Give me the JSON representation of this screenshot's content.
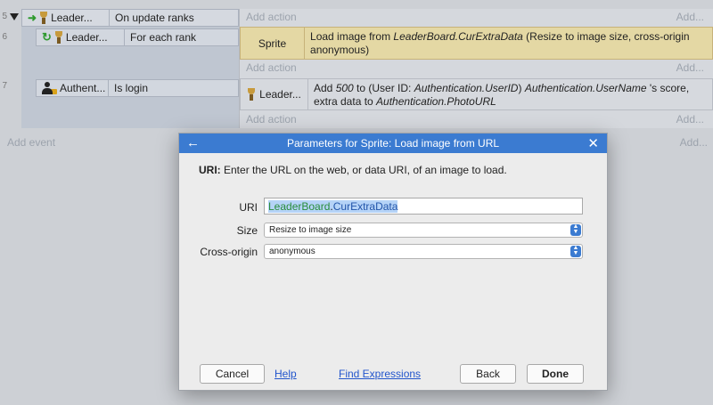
{
  "sheet": {
    "row_numbers": [
      "5",
      "6",
      "7"
    ],
    "events": [
      {
        "object": "Leader...",
        "condition": "On update ranks",
        "add_action": "Add action",
        "add_right": "Add..."
      },
      {
        "object": "Leader...",
        "condition": "For each rank",
        "action_object": "Sprite",
        "action_text_pre": "Load image from ",
        "action_text_em": "LeaderBoard.CurExtraData",
        "action_text_post": " (Resize to image size, cross-origin anonymous)",
        "add_action": "Add action",
        "add_right": "Add..."
      },
      {
        "object": "Authent...",
        "condition": "Is login",
        "action_object": "Leader...",
        "action_line1_a": "Add ",
        "action_line1_b": "500",
        "action_line1_c": " to (User ID: ",
        "action_line1_d": "Authentication.UserID",
        "action_line1_e": ") ",
        "action_line1_f": "Authentication.UserName",
        "action_line1_g": " 's score,",
        "action_line2_a": "extra data to ",
        "action_line2_b": "Authentication.PhotoURL",
        "add_action": "Add action",
        "add_right": "Add..."
      }
    ],
    "add_event": "Add event",
    "add_event_right": "Add..."
  },
  "dialog": {
    "title": "Parameters for Sprite: Load image from URL",
    "intro_bold": "URI:",
    "intro_text": " Enter the URL on the web, or data URI, of an image to load.",
    "params": {
      "uri_label": "URI",
      "uri_value_a": "LeaderBoard",
      "uri_value_b": ".",
      "uri_value_c": "CurExtraData",
      "size_label": "Size",
      "size_value": "Resize to image size",
      "cross_label": "Cross-origin",
      "cross_value": "anonymous"
    },
    "buttons": {
      "cancel": "Cancel",
      "help": "Help",
      "find": "Find Expressions",
      "back": "Back",
      "done": "Done"
    }
  },
  "colors": {
    "titlebar": "#3b7bd1",
    "highlight_action": "#e4d8a4",
    "link": "#2255cc"
  }
}
